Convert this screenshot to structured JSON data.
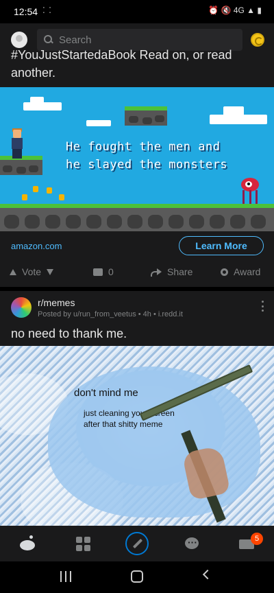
{
  "status_bar": {
    "time": "12:54",
    "indicators": "⁚ ⁚",
    "right_icons": "⏰ 🔇 4G ▲ ▮"
  },
  "header": {
    "search_placeholder": "Search"
  },
  "ad_post": {
    "title_line_1": "#YouJustStartedaBook Read on, or read",
    "title_line_2": "another.",
    "banner_text_line_1": "He fought the men and",
    "banner_text_line_2": "he slayed the monsters",
    "domain": "amazon.com",
    "cta_label": "Learn More",
    "actions": {
      "vote": "Vote",
      "comments": "0",
      "share": "Share",
      "award": "Award"
    }
  },
  "meme_post": {
    "subreddit": "r/memes",
    "meta": "Posted by u/run_from_veetus • 4h • i.redd.it",
    "title": "no need to thank me.",
    "image_text_1": "don't mind me",
    "image_text_2_line_1": "just cleaning your screen",
    "image_text_2_line_2": "after that shitty meme"
  },
  "bottom_nav": {
    "inbox_badge": "5"
  },
  "colors": {
    "accent": "#0079d3",
    "link": "#4fbcff",
    "badge": "#ff4500",
    "background": "#1a1a1b"
  }
}
